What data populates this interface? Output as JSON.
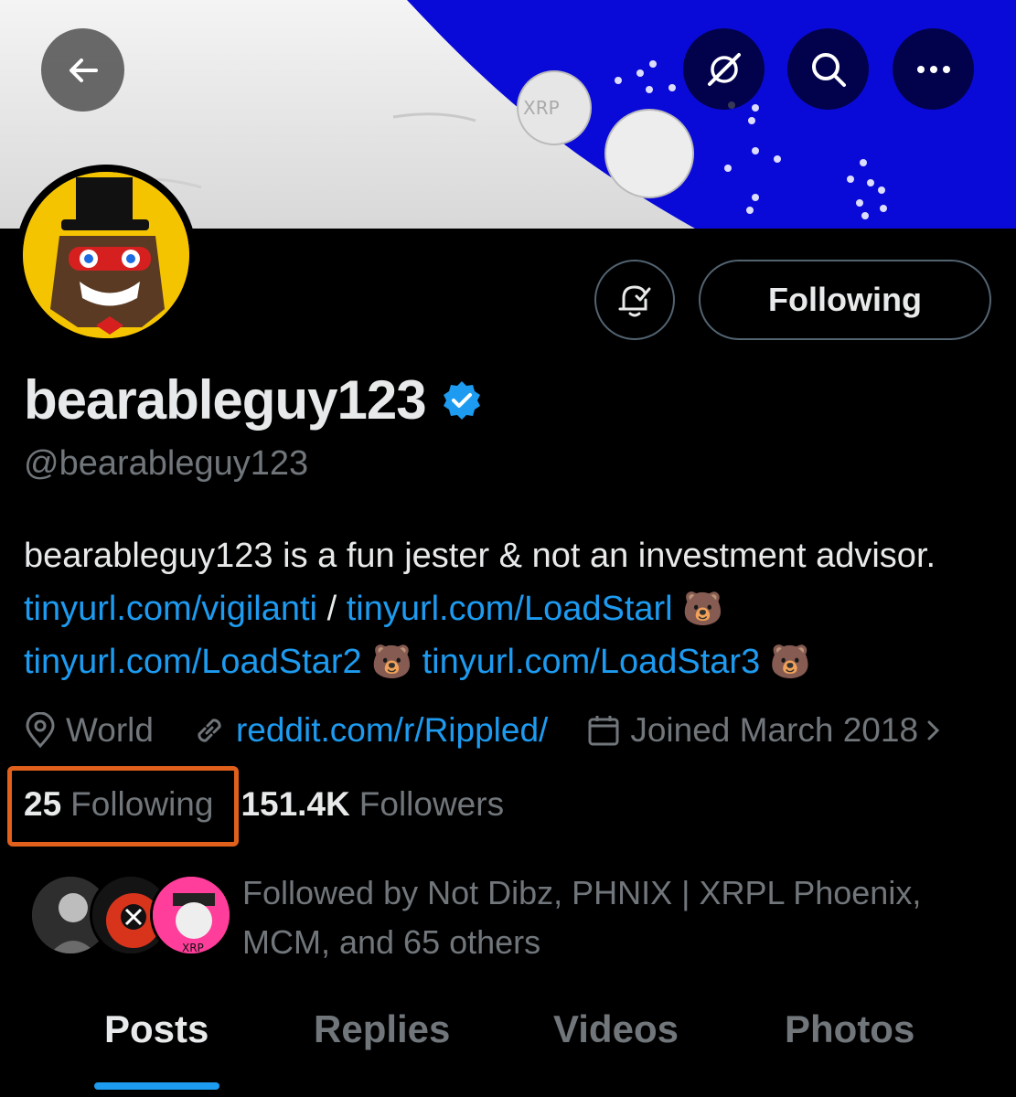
{
  "header": {
    "back_icon": "arrow-left-icon",
    "grok_icon": "grok-slash-icon",
    "search_icon": "search-icon",
    "more_icon": "more-dots-icon",
    "banner_text": "XRP"
  },
  "profile": {
    "display_name": "bearableguy123",
    "handle": "@bearableguy123",
    "verified_color": "#1d9bf0",
    "following_button_label": "Following",
    "bio": {
      "text_1": "bearableguy123 is a fun jester & not an investment advisor.",
      "link_1": "tinyurl.com/vigilanti",
      "separator": "/",
      "link_2": "tinyurl.com/LoadStarl",
      "emoji_1": "🐻",
      "link_3": "tinyurl.com/LoadStar2",
      "emoji_2": "🐻",
      "link_4": "tinyurl.com/LoadStar3",
      "emoji_3": "🐻"
    },
    "location": "World",
    "website": "reddit.com/r/Rippled/",
    "joined": "Joined March 2018",
    "following_count": "25",
    "following_label": "Following",
    "followers_count": "151.4K",
    "followers_label": "Followers",
    "followed_by": "Followed by Not Dibz, PHNIX | XRPL Phoenix, MCM, and 65 others",
    "follower_avatar_text": "XRP",
    "highlight_color": "#e0601c"
  },
  "tabs": [
    {
      "label": "Posts",
      "active": true
    },
    {
      "label": "Replies",
      "active": false
    },
    {
      "label": "Videos",
      "active": false
    },
    {
      "label": "Photos",
      "active": false
    }
  ]
}
